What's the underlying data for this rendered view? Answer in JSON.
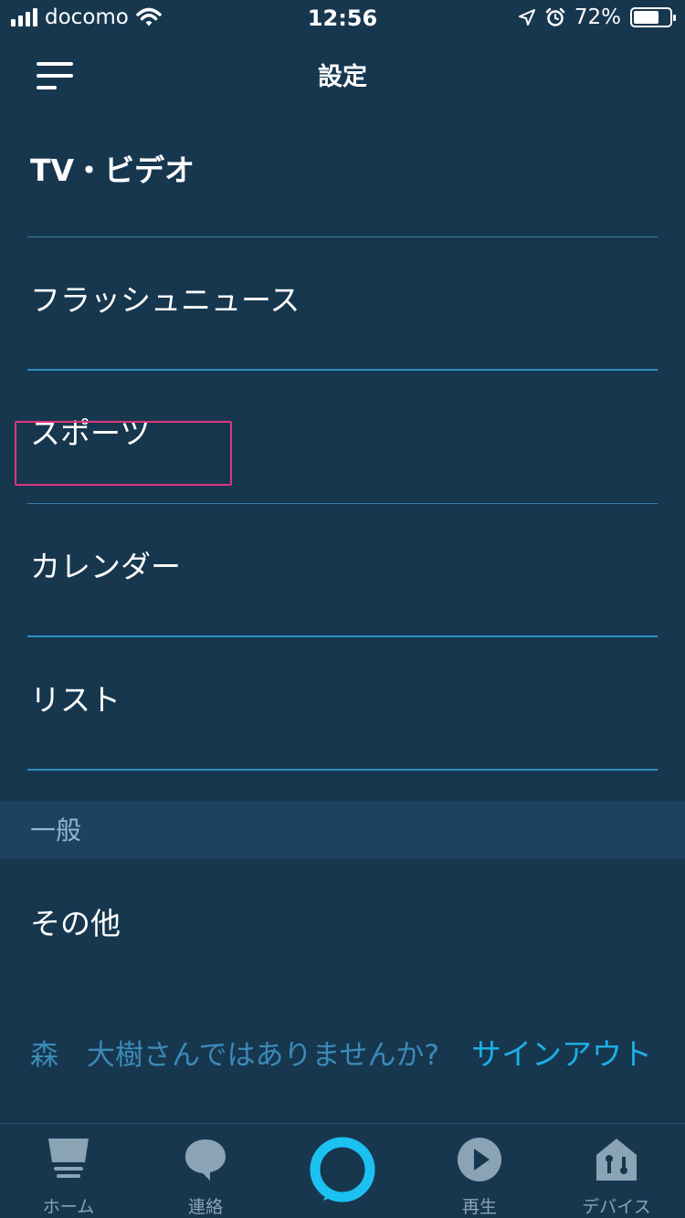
{
  "status": {
    "carrier": "docomo",
    "time": "12:56",
    "battery_percent": "72%",
    "battery_level": 0.72,
    "icons": [
      "signal-icon",
      "wifi-icon",
      "location-icon",
      "alarm-icon",
      "battery-icon"
    ]
  },
  "header": {
    "title": "設定",
    "menu_icon": "hamburger-menu-icon"
  },
  "settings": {
    "items": [
      {
        "label": "TV・ビデオ"
      },
      {
        "label": "フラッシュニュース"
      },
      {
        "label": "スポーツ"
      },
      {
        "label": "カレンダー",
        "highlighted": true
      },
      {
        "label": "リスト"
      }
    ],
    "section_general": "一般",
    "other": "その他"
  },
  "account": {
    "not_user_text": "森　大樹さんではありませんか?",
    "sign_out": "サインアウト"
  },
  "tabs": [
    {
      "label": "ホーム",
      "icon": "home-icon"
    },
    {
      "label": "連絡",
      "icon": "chat-bubble-icon"
    },
    {
      "label": "",
      "icon": "alexa-ring-icon"
    },
    {
      "label": "再生",
      "icon": "play-icon"
    },
    {
      "label": "デバイス",
      "icon": "devices-icon"
    }
  ],
  "colors": {
    "background": "#17374f",
    "accent": "#1cb0e6",
    "highlight": "#e0367a",
    "divider": "#3a7fa8"
  }
}
